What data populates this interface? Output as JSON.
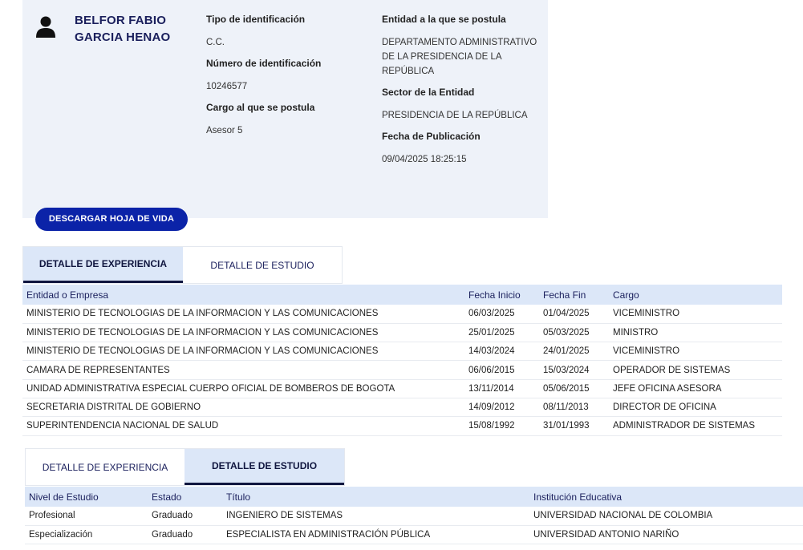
{
  "profile": {
    "name": "BELFOR FABIO GARCIA HENAO",
    "id_type_label": "Tipo de identificación",
    "id_type": "C.C.",
    "id_number_label": "Número de identificación",
    "id_number": "10246577",
    "position_label": "Cargo al que se postula",
    "position": "Asesor 5",
    "entity_label": "Entidad a la que se postula",
    "entity": "DEPARTAMENTO ADMINISTRATIVO DE LA PRESIDENCIA DE LA REPÚBLICA",
    "sector_label": "Sector de la Entidad",
    "sector": "PRESIDENCIA DE LA REPÚBLICA",
    "pub_date_label": "Fecha de Publicación",
    "pub_date": "09/04/2025 18:25:15"
  },
  "download_button": "DESCARGAR HOJA DE VIDA",
  "tabs": {
    "experience": "DETALLE DE EXPERIENCIA",
    "study": "DETALLE DE ESTUDIO"
  },
  "experience": {
    "headers": [
      "Entidad o Empresa",
      "Fecha Inicio",
      "Fecha Fin",
      "Cargo"
    ],
    "rows": [
      [
        "MINISTERIO DE TECNOLOGIAS DE LA INFORMACION Y LAS COMUNICACIONES",
        "06/03/2025",
        "01/04/2025",
        "VICEMINISTRO"
      ],
      [
        "MINISTERIO DE TECNOLOGIAS DE LA INFORMACION Y LAS COMUNICACIONES",
        "25/01/2025",
        "05/03/2025",
        "MINISTRO"
      ],
      [
        "MINISTERIO DE TECNOLOGIAS DE LA INFORMACION Y LAS COMUNICACIONES",
        "14/03/2024",
        "24/01/2025",
        "VICEMINISTRO"
      ],
      [
        "CAMARA DE REPRESENTANTES",
        "06/06/2015",
        "15/03/2024",
        "OPERADOR DE SISTEMAS"
      ],
      [
        "UNIDAD ADMINISTRATIVA ESPECIAL CUERPO OFICIAL DE BOMBEROS DE BOGOTA",
        "13/11/2014",
        "05/06/2015",
        "JEFE OFICINA ASESORA"
      ],
      [
        "SECRETARIA DISTRITAL DE GOBIERNO",
        "14/09/2012",
        "08/11/2013",
        "DIRECTOR DE OFICINA"
      ],
      [
        "SUPERINTENDENCIA NACIONAL DE SALUD",
        "15/08/1992",
        "31/01/1993",
        "ADMINISTRADOR DE SISTEMAS"
      ]
    ]
  },
  "study": {
    "headers": [
      "Nivel de Estudio",
      "Estado",
      "Título",
      "Institución Educativa"
    ],
    "rows": [
      [
        "Profesional",
        "Graduado",
        "INGENIERO DE SISTEMAS",
        "UNIVERSIDAD NACIONAL DE COLOMBIA"
      ],
      [
        "Especialización",
        "Graduado",
        "ESPECIALISTA EN ADMINISTRACIÓN PÚBLICA",
        "UNIVERSIDAD ANTONIO NARIÑO"
      ]
    ]
  }
}
